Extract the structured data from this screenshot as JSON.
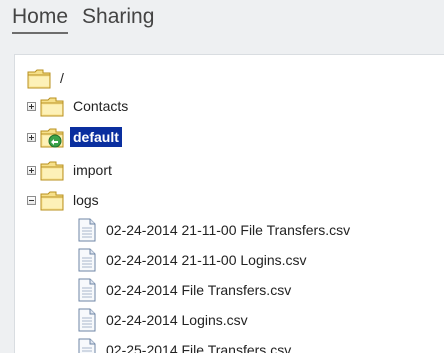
{
  "tabs": [
    {
      "label": "Home",
      "active": true
    },
    {
      "label": "Sharing",
      "active": false
    }
  ],
  "tree": {
    "root": "/",
    "folders": [
      {
        "name": "Contacts",
        "state": "collapsed"
      },
      {
        "name": "default",
        "state": "collapsed",
        "selected": true
      },
      {
        "name": "import",
        "state": "collapsed"
      },
      {
        "name": "logs",
        "state": "expanded"
      }
    ],
    "files": [
      "02-24-2014 21-11-00 File Transfers.csv",
      "02-24-2014 21-11-00 Logins.csv",
      "02-24-2014 File Transfers.csv",
      "02-24-2014 Logins.csv",
      "02-25-2014 File Transfers.csv"
    ]
  },
  "colors": {
    "selection_bg": "#0a2f9f",
    "folder_yellow": "#f3da74",
    "folder_outline": "#b8901f"
  }
}
